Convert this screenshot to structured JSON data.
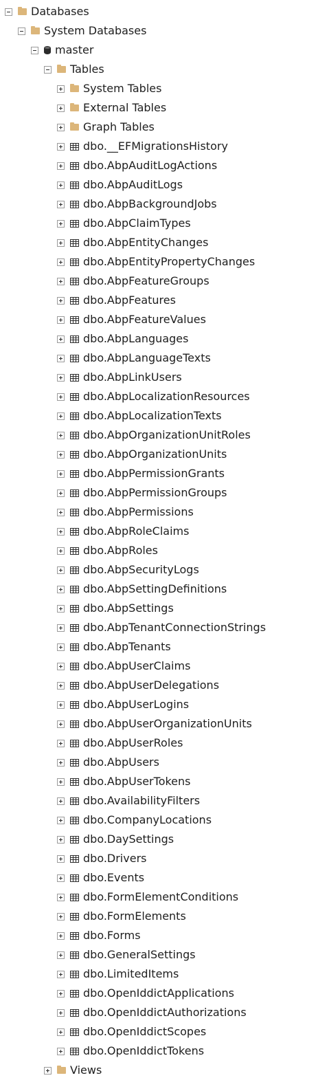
{
  "tree": {
    "databases_label": "Databases",
    "system_databases_label": "System Databases",
    "master_label": "master",
    "tables_label": "Tables",
    "tables_children": [
      {
        "label": "System Tables",
        "icon": "folder-icon"
      },
      {
        "label": "External Tables",
        "icon": "folder-icon"
      },
      {
        "label": "Graph Tables",
        "icon": "folder-icon"
      },
      {
        "label": "dbo.__EFMigrationsHistory",
        "icon": "table-icon"
      },
      {
        "label": "dbo.AbpAuditLogActions",
        "icon": "table-icon"
      },
      {
        "label": "dbo.AbpAuditLogs",
        "icon": "table-icon"
      },
      {
        "label": "dbo.AbpBackgroundJobs",
        "icon": "table-icon"
      },
      {
        "label": "dbo.AbpClaimTypes",
        "icon": "table-icon"
      },
      {
        "label": "dbo.AbpEntityChanges",
        "icon": "table-icon"
      },
      {
        "label": "dbo.AbpEntityPropertyChanges",
        "icon": "table-icon"
      },
      {
        "label": "dbo.AbpFeatureGroups",
        "icon": "table-icon"
      },
      {
        "label": "dbo.AbpFeatures",
        "icon": "table-icon"
      },
      {
        "label": "dbo.AbpFeatureValues",
        "icon": "table-icon"
      },
      {
        "label": "dbo.AbpLanguages",
        "icon": "table-icon"
      },
      {
        "label": "dbo.AbpLanguageTexts",
        "icon": "table-icon"
      },
      {
        "label": "dbo.AbpLinkUsers",
        "icon": "table-icon"
      },
      {
        "label": "dbo.AbpLocalizationResources",
        "icon": "table-icon"
      },
      {
        "label": "dbo.AbpLocalizationTexts",
        "icon": "table-icon"
      },
      {
        "label": "dbo.AbpOrganizationUnitRoles",
        "icon": "table-icon"
      },
      {
        "label": "dbo.AbpOrganizationUnits",
        "icon": "table-icon"
      },
      {
        "label": "dbo.AbpPermissionGrants",
        "icon": "table-icon"
      },
      {
        "label": "dbo.AbpPermissionGroups",
        "icon": "table-icon"
      },
      {
        "label": "dbo.AbpPermissions",
        "icon": "table-icon"
      },
      {
        "label": "dbo.AbpRoleClaims",
        "icon": "table-icon"
      },
      {
        "label": "dbo.AbpRoles",
        "icon": "table-icon"
      },
      {
        "label": "dbo.AbpSecurityLogs",
        "icon": "table-icon"
      },
      {
        "label": "dbo.AbpSettingDefinitions",
        "icon": "table-icon"
      },
      {
        "label": "dbo.AbpSettings",
        "icon": "table-icon"
      },
      {
        "label": "dbo.AbpTenantConnectionStrings",
        "icon": "table-icon"
      },
      {
        "label": "dbo.AbpTenants",
        "icon": "table-icon"
      },
      {
        "label": "dbo.AbpUserClaims",
        "icon": "table-icon"
      },
      {
        "label": "dbo.AbpUserDelegations",
        "icon": "table-icon"
      },
      {
        "label": "dbo.AbpUserLogins",
        "icon": "table-icon"
      },
      {
        "label": "dbo.AbpUserOrganizationUnits",
        "icon": "table-icon"
      },
      {
        "label": "dbo.AbpUserRoles",
        "icon": "table-icon"
      },
      {
        "label": "dbo.AbpUsers",
        "icon": "table-icon"
      },
      {
        "label": "dbo.AbpUserTokens",
        "icon": "table-icon"
      },
      {
        "label": "dbo.AvailabilityFilters",
        "icon": "table-icon"
      },
      {
        "label": "dbo.CompanyLocations",
        "icon": "table-icon"
      },
      {
        "label": "dbo.DaySettings",
        "icon": "table-icon"
      },
      {
        "label": "dbo.Drivers",
        "icon": "table-icon"
      },
      {
        "label": "dbo.Events",
        "icon": "table-icon"
      },
      {
        "label": "dbo.FormElementConditions",
        "icon": "table-icon"
      },
      {
        "label": "dbo.FormElements",
        "icon": "table-icon"
      },
      {
        "label": "dbo.Forms",
        "icon": "table-icon"
      },
      {
        "label": "dbo.GeneralSettings",
        "icon": "table-icon"
      },
      {
        "label": "dbo.LimitedItems",
        "icon": "table-icon"
      },
      {
        "label": "dbo.OpenIddictApplications",
        "icon": "table-icon"
      },
      {
        "label": "dbo.OpenIddictAuthorizations",
        "icon": "table-icon"
      },
      {
        "label": "dbo.OpenIddictScopes",
        "icon": "table-icon"
      },
      {
        "label": "dbo.OpenIddictTokens",
        "icon": "table-icon"
      }
    ],
    "views_label": "Views"
  }
}
